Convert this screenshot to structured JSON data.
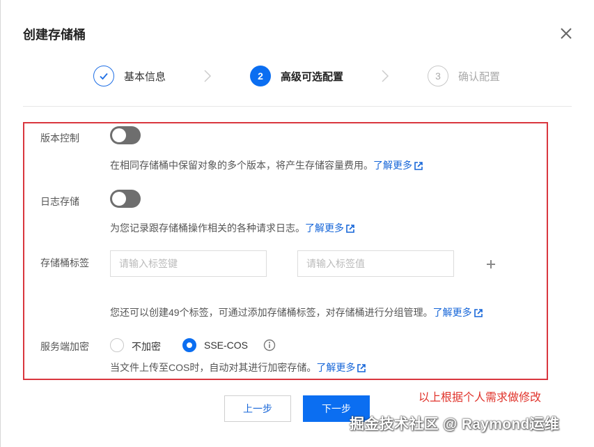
{
  "dialog": {
    "title": "创建存储桶"
  },
  "steps": [
    {
      "number": "1",
      "label": "基本信息",
      "state": "done"
    },
    {
      "number": "2",
      "label": "高级可选配置",
      "state": "active"
    },
    {
      "number": "3",
      "label": "确认配置",
      "state": "pending"
    }
  ],
  "versioning": {
    "label": "版本控制",
    "enabled": false,
    "description": "在相同存储桶中保留对象的多个版本，将产生存储容量费用。",
    "link": "了解更多"
  },
  "logging": {
    "label": "日志存储",
    "enabled": false,
    "description": "为您记录跟存储桶操作相关的各种请求日志。",
    "link": "了解更多"
  },
  "tags": {
    "label": "存储桶标签",
    "key_placeholder": "请输入标签键",
    "value_placeholder": "请输入标签值",
    "description": "您还可以创建49个标签，可通过添加存储桶标签，对存储桶进行分组管理。",
    "link": "了解更多"
  },
  "encryption": {
    "label": "服务端加密",
    "options": [
      {
        "label": "不加密",
        "selected": false
      },
      {
        "label": "SSE-COS",
        "selected": true
      }
    ],
    "description": "当文件上传至COS时，自动对其进行加密存储。",
    "link": "了解更多"
  },
  "annotation": "以上根据个人需求做修改",
  "buttons": {
    "prev": "上一步",
    "next": "下一步"
  },
  "watermark": "掘金技术社区 @ Raymond运维",
  "colors": {
    "primary": "#0b6ef1",
    "link": "#1565d8",
    "annotation": "#d9363e",
    "toggle_off": "#6e6e6e"
  },
  "icons": {
    "close": "close-icon",
    "check": "check-icon",
    "chevron": "chevron-right-icon",
    "external": "external-link-icon",
    "plus": "plus-icon",
    "info": "info-icon"
  }
}
